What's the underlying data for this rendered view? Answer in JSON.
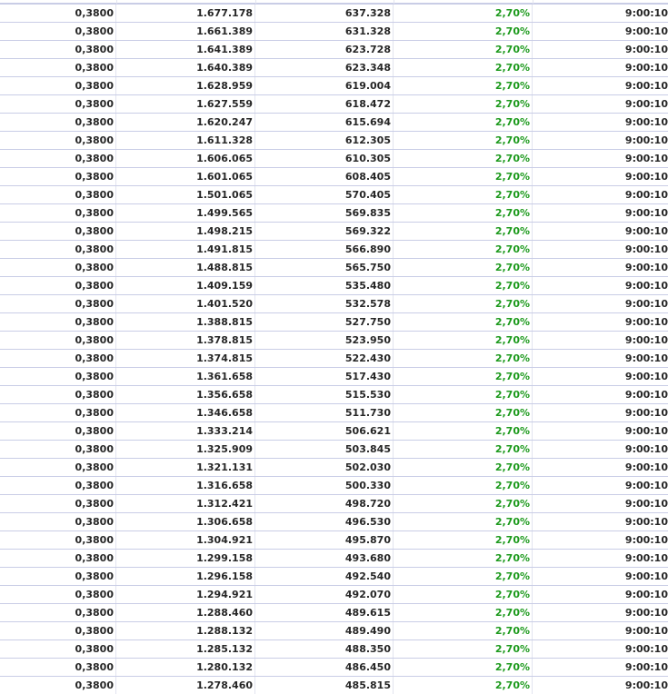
{
  "table": {
    "rows": [
      {
        "price": "0,3800",
        "total": "1.677.178",
        "amount": "637.328",
        "pct": "2,70%",
        "time": "9:00:10"
      },
      {
        "price": "0,3800",
        "total": "1.661.389",
        "amount": "631.328",
        "pct": "2,70%",
        "time": "9:00:10"
      },
      {
        "price": "0,3800",
        "total": "1.641.389",
        "amount": "623.728",
        "pct": "2,70%",
        "time": "9:00:10"
      },
      {
        "price": "0,3800",
        "total": "1.640.389",
        "amount": "623.348",
        "pct": "2,70%",
        "time": "9:00:10"
      },
      {
        "price": "0,3800",
        "total": "1.628.959",
        "amount": "619.004",
        "pct": "2,70%",
        "time": "9:00:10"
      },
      {
        "price": "0,3800",
        "total": "1.627.559",
        "amount": "618.472",
        "pct": "2,70%",
        "time": "9:00:10"
      },
      {
        "price": "0,3800",
        "total": "1.620.247",
        "amount": "615.694",
        "pct": "2,70%",
        "time": "9:00:10"
      },
      {
        "price": "0,3800",
        "total": "1.611.328",
        "amount": "612.305",
        "pct": "2,70%",
        "time": "9:00:10"
      },
      {
        "price": "0,3800",
        "total": "1.606.065",
        "amount": "610.305",
        "pct": "2,70%",
        "time": "9:00:10"
      },
      {
        "price": "0,3800",
        "total": "1.601.065",
        "amount": "608.405",
        "pct": "2,70%",
        "time": "9:00:10"
      },
      {
        "price": "0,3800",
        "total": "1.501.065",
        "amount": "570.405",
        "pct": "2,70%",
        "time": "9:00:10"
      },
      {
        "price": "0,3800",
        "total": "1.499.565",
        "amount": "569.835",
        "pct": "2,70%",
        "time": "9:00:10"
      },
      {
        "price": "0,3800",
        "total": "1.498.215",
        "amount": "569.322",
        "pct": "2,70%",
        "time": "9:00:10"
      },
      {
        "price": "0,3800",
        "total": "1.491.815",
        "amount": "566.890",
        "pct": "2,70%",
        "time": "9:00:10"
      },
      {
        "price": "0,3800",
        "total": "1.488.815",
        "amount": "565.750",
        "pct": "2,70%",
        "time": "9:00:10"
      },
      {
        "price": "0,3800",
        "total": "1.409.159",
        "amount": "535.480",
        "pct": "2,70%",
        "time": "9:00:10"
      },
      {
        "price": "0,3800",
        "total": "1.401.520",
        "amount": "532.578",
        "pct": "2,70%",
        "time": "9:00:10"
      },
      {
        "price": "0,3800",
        "total": "1.388.815",
        "amount": "527.750",
        "pct": "2,70%",
        "time": "9:00:10"
      },
      {
        "price": "0,3800",
        "total": "1.378.815",
        "amount": "523.950",
        "pct": "2,70%",
        "time": "9:00:10"
      },
      {
        "price": "0,3800",
        "total": "1.374.815",
        "amount": "522.430",
        "pct": "2,70%",
        "time": "9:00:10"
      },
      {
        "price": "0,3800",
        "total": "1.361.658",
        "amount": "517.430",
        "pct": "2,70%",
        "time": "9:00:10"
      },
      {
        "price": "0,3800",
        "total": "1.356.658",
        "amount": "515.530",
        "pct": "2,70%",
        "time": "9:00:10"
      },
      {
        "price": "0,3800",
        "total": "1.346.658",
        "amount": "511.730",
        "pct": "2,70%",
        "time": "9:00:10"
      },
      {
        "price": "0,3800",
        "total": "1.333.214",
        "amount": "506.621",
        "pct": "2,70%",
        "time": "9:00:10"
      },
      {
        "price": "0,3800",
        "total": "1.325.909",
        "amount": "503.845",
        "pct": "2,70%",
        "time": "9:00:10"
      },
      {
        "price": "0,3800",
        "total": "1.321.131",
        "amount": "502.030",
        "pct": "2,70%",
        "time": "9:00:10"
      },
      {
        "price": "0,3800",
        "total": "1.316.658",
        "amount": "500.330",
        "pct": "2,70%",
        "time": "9:00:10"
      },
      {
        "price": "0,3800",
        "total": "1.312.421",
        "amount": "498.720",
        "pct": "2,70%",
        "time": "9:00:10"
      },
      {
        "price": "0,3800",
        "total": "1.306.658",
        "amount": "496.530",
        "pct": "2,70%",
        "time": "9:00:10"
      },
      {
        "price": "0,3800",
        "total": "1.304.921",
        "amount": "495.870",
        "pct": "2,70%",
        "time": "9:00:10"
      },
      {
        "price": "0,3800",
        "total": "1.299.158",
        "amount": "493.680",
        "pct": "2,70%",
        "time": "9:00:10"
      },
      {
        "price": "0,3800",
        "total": "1.296.158",
        "amount": "492.540",
        "pct": "2,70%",
        "time": "9:00:10"
      },
      {
        "price": "0,3800",
        "total": "1.294.921",
        "amount": "492.070",
        "pct": "2,70%",
        "time": "9:00:10"
      },
      {
        "price": "0,3800",
        "total": "1.288.460",
        "amount": "489.615",
        "pct": "2,70%",
        "time": "9:00:10"
      },
      {
        "price": "0,3800",
        "total": "1.288.132",
        "amount": "489.490",
        "pct": "2,70%",
        "time": "9:00:10"
      },
      {
        "price": "0,3800",
        "total": "1.285.132",
        "amount": "488.350",
        "pct": "2,70%",
        "time": "9:00:10"
      },
      {
        "price": "0,3800",
        "total": "1.280.132",
        "amount": "486.450",
        "pct": "2,70%",
        "time": "9:00:10"
      },
      {
        "price": "0,3800",
        "total": "1.278.460",
        "amount": "485.815",
        "pct": "2,70%",
        "time": "9:00:10"
      }
    ]
  },
  "colors": {
    "pct_text": "#1d9a1d",
    "text": "#262626",
    "row_border": "#c9cde6"
  }
}
